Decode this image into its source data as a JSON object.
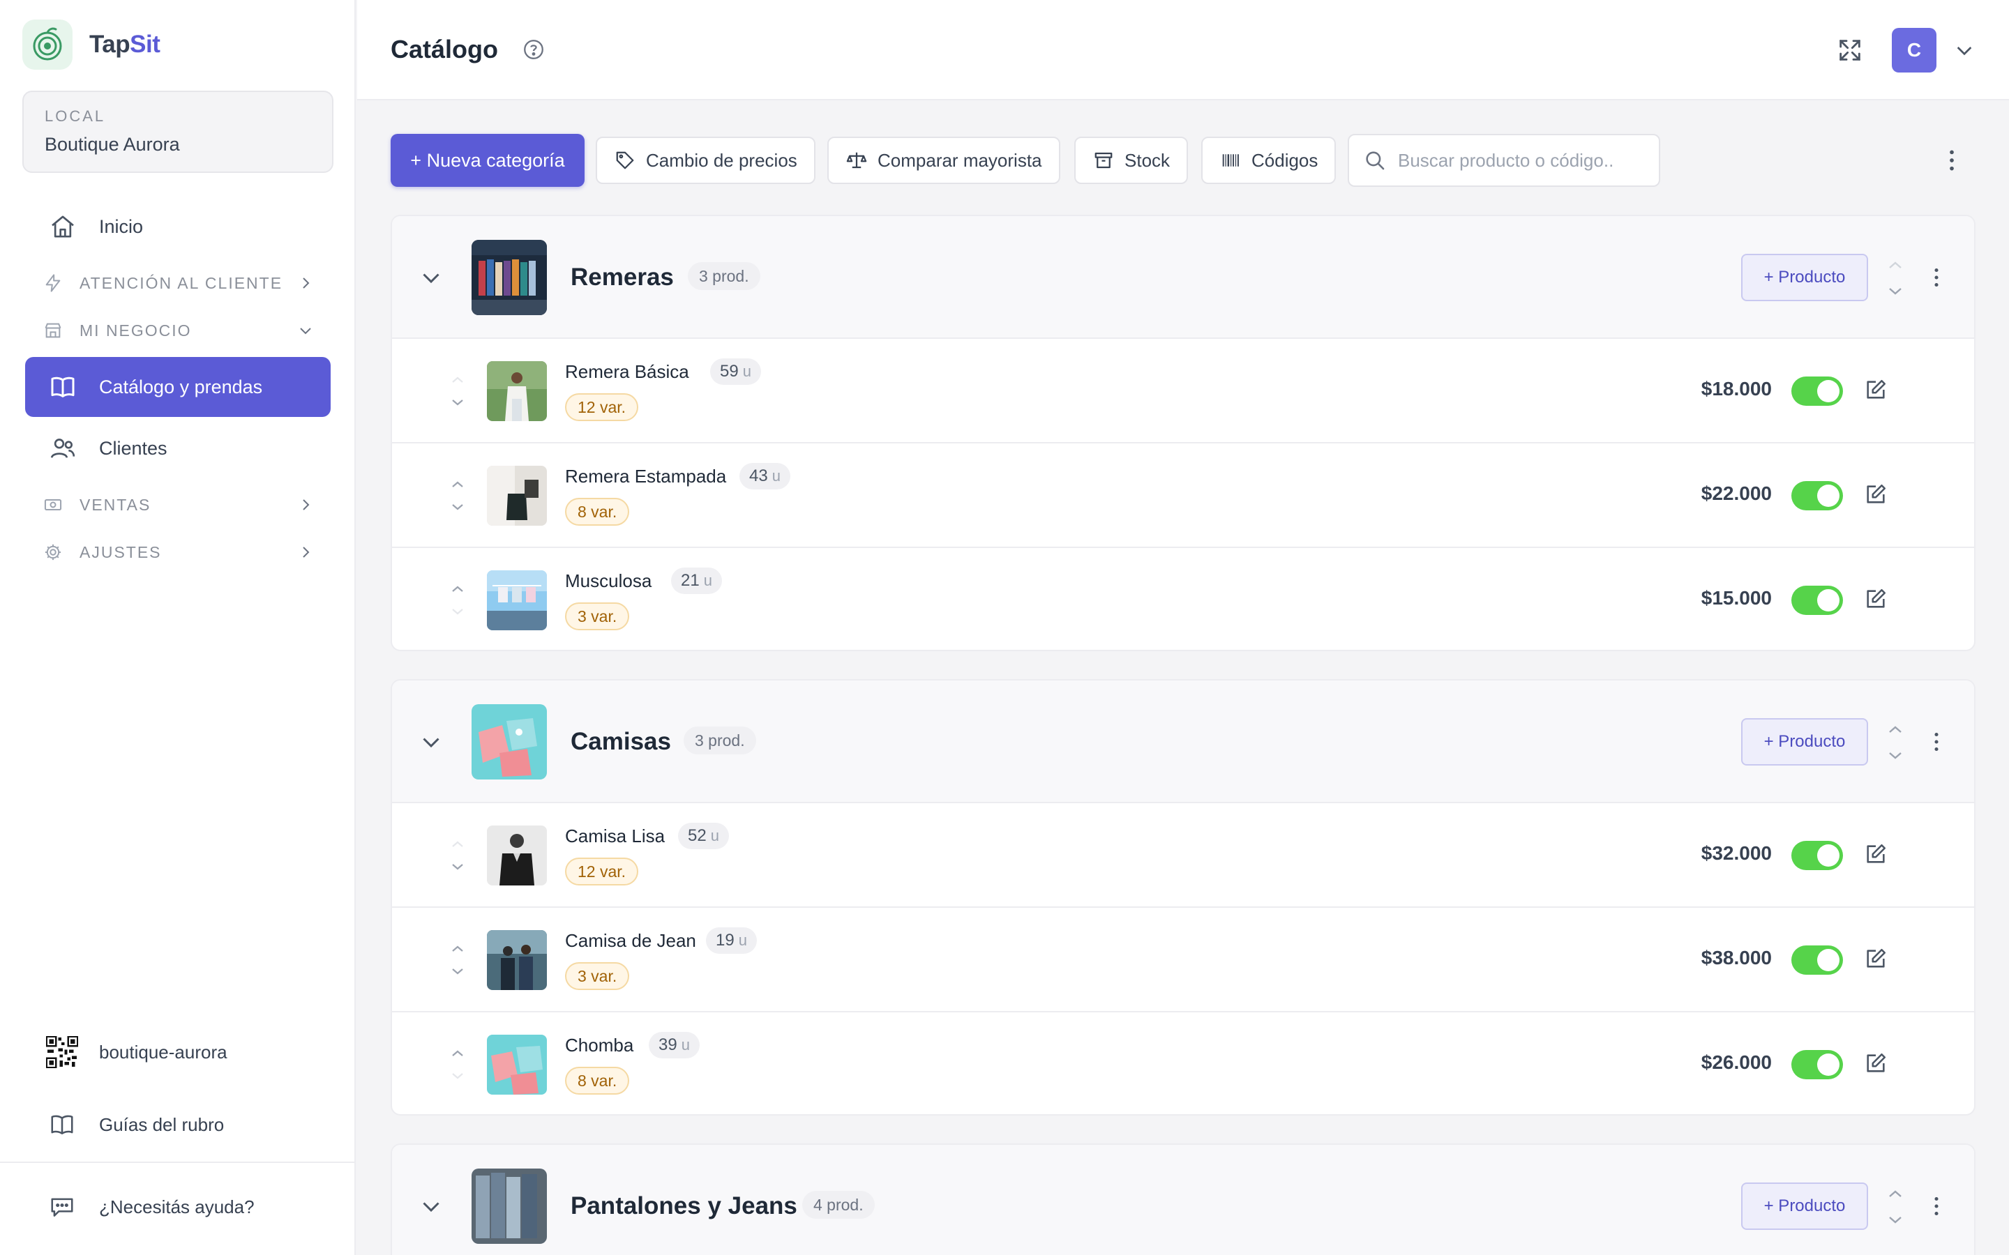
{
  "brand": {
    "name_part1": "Tap",
    "name_part2": "Sit"
  },
  "local": {
    "label": "LOCAL",
    "name": "Boutique Aurora"
  },
  "nav": {
    "inicio": "Inicio",
    "atencion": "ATENCIÓN AL CLIENTE",
    "mi_negocio": "MI NEGOCIO",
    "catalogo": "Catálogo y prendas",
    "clientes": "Clientes",
    "ventas": "VENTAS",
    "ajustes": "AJUSTES"
  },
  "footer": {
    "qr_label": "boutique-aurora",
    "guias": "Guías del rubro",
    "ayuda": "¿Necesitás ayuda?"
  },
  "header": {
    "title": "Catálogo",
    "avatar_initial": "C"
  },
  "toolbar": {
    "nueva_categoria": "+ Nueva categoría",
    "cambio_precios": "Cambio de precios",
    "comparar_mayorista": "Comparar mayorista",
    "stock": "Stock",
    "codigos": "Códigos",
    "search_placeholder": "Buscar producto o código.."
  },
  "add_product_label": "+ Producto",
  "categories": [
    {
      "name": "Remeras",
      "count": "3 prod.",
      "products": [
        {
          "name": "Remera Básica",
          "stock": "59",
          "unit": "u",
          "variants": "12 var.",
          "price": "$18.000",
          "active": true
        },
        {
          "name": "Remera Estampada",
          "stock": "43",
          "unit": "u",
          "variants": "8 var.",
          "price": "$22.000",
          "active": true
        },
        {
          "name": "Musculosa",
          "stock": "21",
          "unit": "u",
          "variants": "3 var.",
          "price": "$15.000",
          "active": true
        }
      ]
    },
    {
      "name": "Camisas",
      "count": "3 prod.",
      "products": [
        {
          "name": "Camisa Lisa",
          "stock": "52",
          "unit": "u",
          "variants": "12 var.",
          "price": "$32.000",
          "active": true
        },
        {
          "name": "Camisa de Jean",
          "stock": "19",
          "unit": "u",
          "variants": "3 var.",
          "price": "$38.000",
          "active": true
        },
        {
          "name": "Chomba",
          "stock": "39",
          "unit": "u",
          "variants": "8 var.",
          "price": "$26.000",
          "active": true
        }
      ]
    },
    {
      "name": "Pantalones y Jeans",
      "count": "4 prod.",
      "products": []
    }
  ],
  "colors": {
    "accent": "#5b5bd6",
    "toggle_on": "#56d34a",
    "variant_bg": "#fff6e6"
  }
}
